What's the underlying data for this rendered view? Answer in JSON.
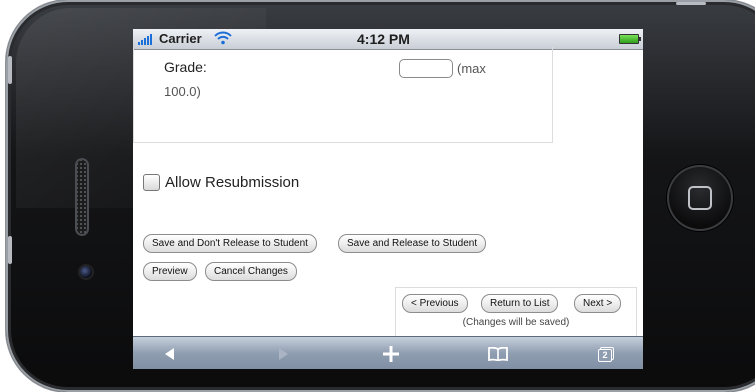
{
  "statusbar": {
    "carrier": "Carrier",
    "time": "4:12 PM"
  },
  "grade": {
    "label": "Grade:",
    "input_value": "",
    "max_line1": "(max",
    "max_line2": "100.0)"
  },
  "resubmission": {
    "label": "Allow Resubmission",
    "checked": false
  },
  "buttons": {
    "save_no_release": "Save and Don't Release to Student",
    "save_release": "Save and Release to Student",
    "preview": "Preview",
    "cancel": "Cancel Changes"
  },
  "navigation": {
    "previous": "< Previous",
    "return_to_list": "Return to List",
    "next": "Next >",
    "note": "(Changes will be saved)"
  },
  "toolbar": {
    "back_icon": "back-arrow",
    "forward_icon": "forward-arrow",
    "add_icon": "plus",
    "bookmarks_icon": "open-book",
    "pages_icon": "pages",
    "pages_count": "2"
  },
  "colors": {
    "toolbar": "#8f9db0",
    "signal": "#1d6fd8",
    "battery": "#2e9e1a"
  }
}
